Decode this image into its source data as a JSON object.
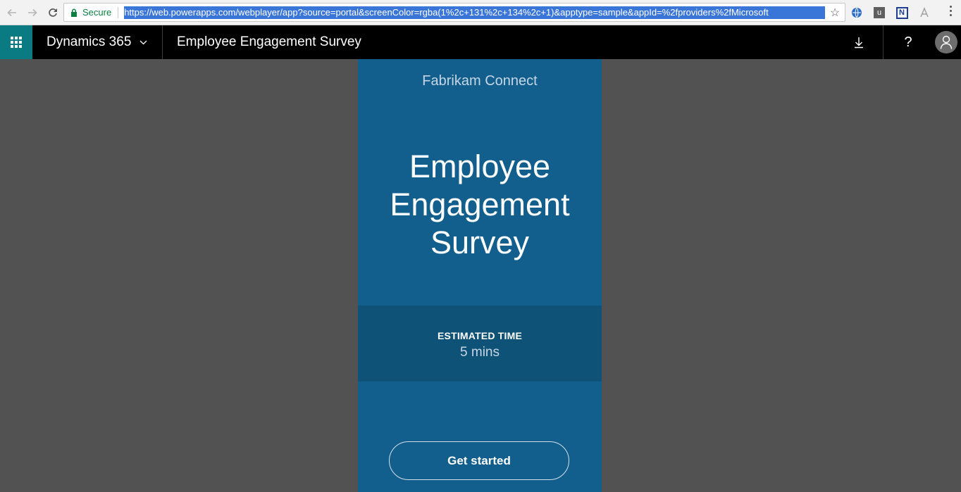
{
  "browser": {
    "secure_label": "Secure",
    "url": "https://web.powerapps.com/webplayer/app?source=portal&screenColor=rgba(1%2c+131%2c+134%2c+1)&apptype=sample&appId=%2fproviders%2fMicrosoft",
    "ext_u": "u",
    "ext_n": "N"
  },
  "header": {
    "brand": "Dynamics 365",
    "app_title": "Employee Engagement Survey",
    "help": "?"
  },
  "survey": {
    "company": "Fabrikam Connect",
    "title_line1": "Employee",
    "title_line2": "Engagement",
    "title_line3": "Survey",
    "time_label": "ESTIMATED TIME",
    "time_value": "5 mins",
    "start_label": "Get started"
  },
  "colors": {
    "waffle_bg": "#0a7b83",
    "panel_bg": "#125e8c",
    "time_band_bg": "#0f5277",
    "canvas_bg": "#525252"
  }
}
